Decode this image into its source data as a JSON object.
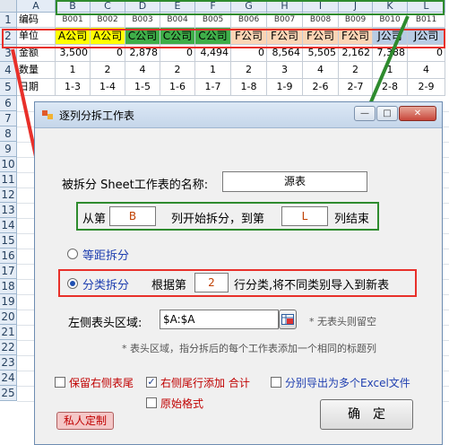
{
  "sheet": {
    "col_headers": [
      "A",
      "B",
      "C",
      "D",
      "E",
      "F",
      "G",
      "H",
      "I",
      "J",
      "K",
      "L"
    ],
    "row_headers": [
      "1",
      "2",
      "3",
      "4",
      "5",
      "6",
      "7",
      "8",
      "9",
      "10",
      "11",
      "12",
      "13",
      "14",
      "15",
      "16",
      "17",
      "18",
      "19",
      "20",
      "21",
      "22",
      "23",
      "24",
      "25"
    ],
    "row1": {
      "label": "编码",
      "values": [
        "B001",
        "B002",
        "B003",
        "B004",
        "B005",
        "B006",
        "B007",
        "B008",
        "B009",
        "B010",
        "B011"
      ]
    },
    "row2": {
      "label": "单位",
      "values": [
        "A公司",
        "A公司",
        "C公司",
        "C公司",
        "C公司",
        "F公司",
        "F公司",
        "F公司",
        "F公司",
        "J公司",
        "J公司"
      ]
    },
    "row3": {
      "label": "金额",
      "values": [
        "3,500",
        "0",
        "2,878",
        "0",
        "4,494",
        "0",
        "8,564",
        "5,505",
        "2,162",
        "7,388",
        "0"
      ]
    },
    "row4": {
      "label": "数量",
      "values": [
        "1",
        "2",
        "4",
        "2",
        "1",
        "2",
        "3",
        "4",
        "2",
        "1",
        "4"
      ]
    },
    "row5": {
      "label": "日期",
      "values": [
        "1-3",
        "1-4",
        "1-5",
        "1-6",
        "1-7",
        "1-8",
        "1-9",
        "2-6",
        "2-7",
        "2-8",
        "2-9"
      ]
    },
    "unit_colors": {
      "A公司": "#ffff00",
      "C公司": "#3fae49",
      "F公司": "#fbd5b5",
      "J公司": "#b8cce4"
    }
  },
  "dialog": {
    "title": "逐列分拆工作表",
    "controls": {
      "minimize": "—",
      "maximize": "□",
      "close": "✕"
    },
    "sheet_name_label": "被拆分 Sheet工作表的名称:",
    "sheet_name_value": "源表",
    "from_label": "从第",
    "from_value": "B",
    "middle_label": "列开始拆分，到第",
    "to_value": "L",
    "end_label": "列结束",
    "radio_equal": "等距拆分",
    "radio_category": "分类拆分",
    "based_on_label": "根据第",
    "based_on_value": "2",
    "category_desc": "行分类,将不同类别导入到新表",
    "left_header_label": "左侧表头区域:",
    "left_header_value": "$A:$A",
    "no_header_hint": "* 无表头则留空",
    "header_note": "* 表头区域，指分拆后的每个工作表添加一个相同的标题列",
    "keep_right_tail": "保留右侧表尾",
    "add_tail_right": "右侧尾行添加 合计",
    "export_excel": "分别导出为多个Excel文件",
    "original_format": "原始格式",
    "custom_button": "私人定制",
    "ok_button": "确　定",
    "checked": {
      "keep_right_tail": false,
      "add_tail_right": true,
      "export_excel": false,
      "original_format": false
    },
    "selected_mode": "分类拆分"
  }
}
